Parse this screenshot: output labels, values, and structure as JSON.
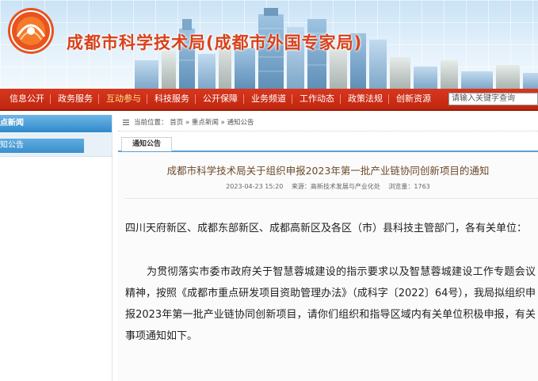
{
  "header": {
    "site_title": "成都市科学技术局(成都市外国专家局)"
  },
  "nav": {
    "items": [
      {
        "label": "信息公开",
        "active": false
      },
      {
        "label": "政务服务",
        "active": false
      },
      {
        "label": "互动参与",
        "active": true
      },
      {
        "label": "科技服务",
        "active": false
      },
      {
        "label": "公开保障",
        "active": false
      },
      {
        "label": "业务频道",
        "active": false
      },
      {
        "label": "工作动态",
        "active": false
      },
      {
        "label": "政策法规",
        "active": false
      },
      {
        "label": "创新资源",
        "active": false
      }
    ],
    "search_placeholder": "请输入关键字查询"
  },
  "sidebar": {
    "heading": "点新闻",
    "item": "知公告"
  },
  "breadcrumb": {
    "label": "当前位置：",
    "path": [
      "首页",
      "重点新闻",
      "通知公告"
    ],
    "sep": "»"
  },
  "tab": {
    "label": "通知公告"
  },
  "article": {
    "title": "成都市科学技术局关于组织申报2023年第一批产业链协同创新项目的通知",
    "date": "2023-04-23 15:20",
    "source": "来源：高新技术发展与产业化处",
    "views": "浏览量：1763",
    "para1": "四川天府新区、成都东部新区、成都高新区及各区（市）县科技主管部门，各有关单位：",
    "para2": "为贯彻落实市委市政府关于智慧蓉城建设的指示要求以及智慧蓉城建设工作专题会议精神，按照《成都市重点研发项目资助管理办法》（成科字〔2022〕64号），我局拟组织申报2023年第一批产业链协同创新项目，请你们组织和指导区域内有关单位积极申报，有关事项通知如下。"
  },
  "colors": {
    "nav_bg": "#c92d14",
    "title_red": "#d9411a",
    "accent_blue": "#2f89cb"
  }
}
